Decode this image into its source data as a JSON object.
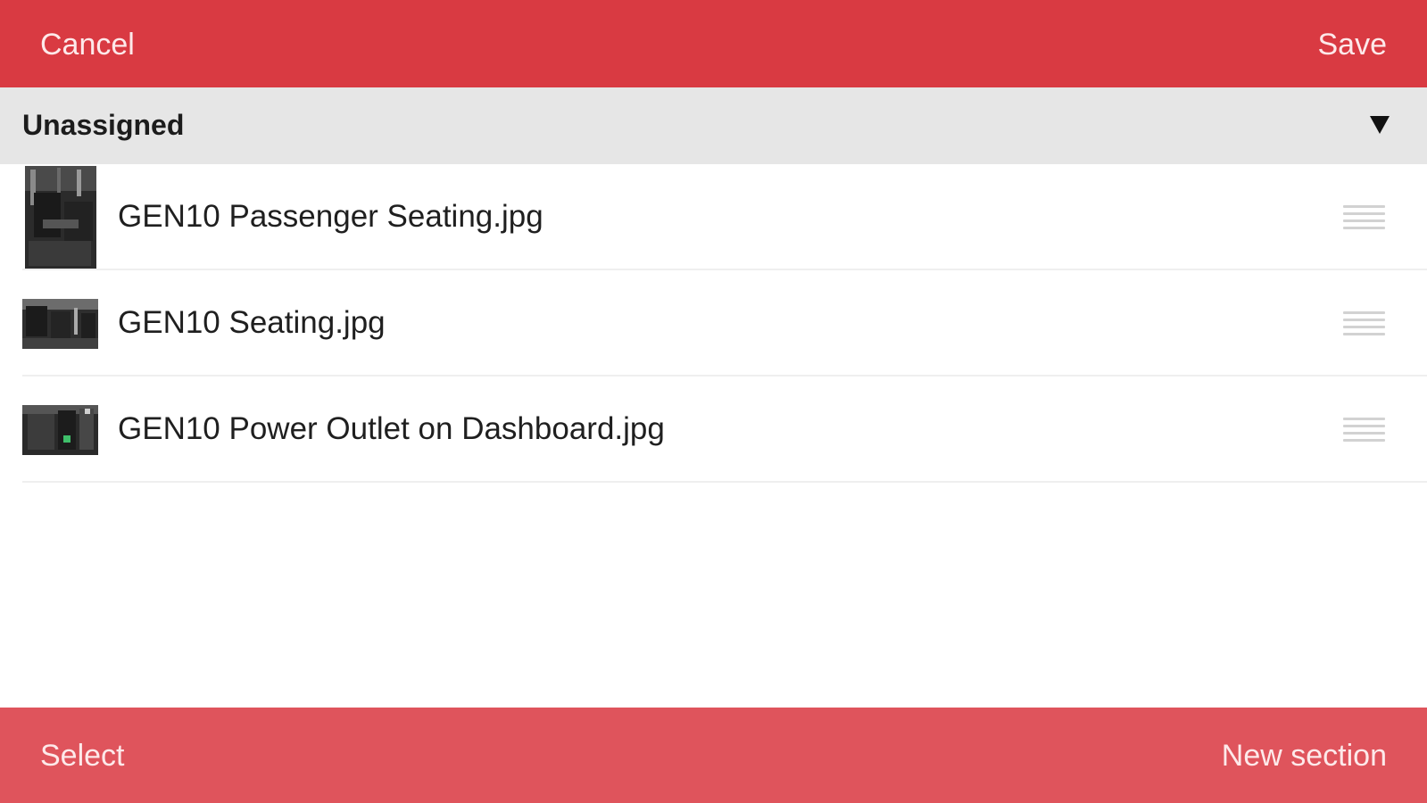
{
  "navbar": {
    "cancel_label": "Cancel",
    "save_label": "Save",
    "background_color": "#d93a42"
  },
  "section": {
    "title": "Unassigned",
    "expanded_icon": "caret-down-icon",
    "background_color": "#e6e6e6"
  },
  "files": [
    {
      "name": "GEN10 Passenger Seating.jpg",
      "thumbnail": "seating-photo-portrait",
      "handle_icon": "drag-handle-icon"
    },
    {
      "name": "GEN10 Seating.jpg",
      "thumbnail": "seating-photo-landscape",
      "handle_icon": "drag-handle-icon"
    },
    {
      "name": "GEN10 Power Outlet on Dashboard.jpg",
      "thumbnail": "dashboard-outlet-photo",
      "handle_icon": "drag-handle-icon"
    }
  ],
  "toolbar": {
    "select_label": "Select",
    "new_section_label": "New section",
    "background_color": "#df545c"
  }
}
